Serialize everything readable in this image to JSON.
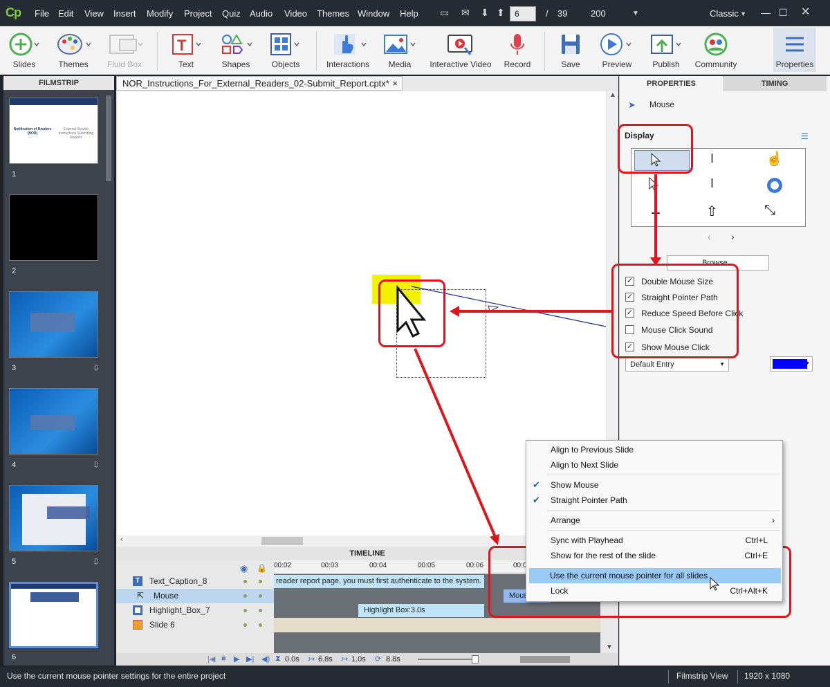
{
  "app": {
    "logo": "Cp",
    "workspace": "Classic"
  },
  "menu": [
    "File",
    "Edit",
    "View",
    "Insert",
    "Modify",
    "Project",
    "Quiz",
    "Audio",
    "Video",
    "Themes",
    "Window",
    "Help"
  ],
  "nav": {
    "current_page": "6",
    "separator": "/",
    "total_pages": "39",
    "zoom": "200"
  },
  "toolbar": [
    "Slides",
    "Themes",
    "Fluid Box",
    "Text",
    "Shapes",
    "Objects",
    "Interactions",
    "Media",
    "Interactive Video",
    "Record",
    "Save",
    "Preview",
    "Publish",
    "Community",
    "Properties"
  ],
  "filmstrip": {
    "title": "FILMSTRIP",
    "slide1_title": "Notification of Readers (NOR)",
    "slide1_subtitle": "External Reader Instructions Submitting Reports",
    "numbers": [
      "1",
      "2",
      "3",
      "4",
      "5",
      "6"
    ]
  },
  "document": {
    "tab_title": "NOR_Instructions_For_External_Readers_02-Submit_Report.cptx*",
    "close": "×"
  },
  "timeline": {
    "title": "TIMELINE",
    "ticks": [
      "00:02",
      "00:03",
      "00:04",
      "00:05",
      "00:06",
      "00:0"
    ],
    "layers": [
      {
        "name": "Text_Caption_8",
        "bar": "reader report page, you must first authenticate to the system.   The fi..."
      },
      {
        "name": "Mouse",
        "bar": "Mous"
      },
      {
        "name": "Highlight_Box_7",
        "bar": "Highlight Box:3.0s"
      },
      {
        "name": "Slide 6",
        "bar": ""
      }
    ],
    "footer": {
      "start": "0.0s",
      "duration": "6.8s",
      "mid": "1.0s",
      "end": "8.8s"
    }
  },
  "properties": {
    "tab_properties": "PROPERTIES",
    "tab_timing": "TIMING",
    "object_type": "Mouse",
    "section": "Display",
    "browse": "Browse...",
    "options": [
      {
        "label": "Double Mouse Size",
        "checked": true
      },
      {
        "label": "Straight Pointer Path",
        "checked": true
      },
      {
        "label": "Reduce Speed Before Click",
        "checked": true
      },
      {
        "label": "Mouse Click Sound",
        "checked": false
      },
      {
        "label": "Show Mouse Click",
        "checked": true
      }
    ],
    "entry": "Default Entry",
    "click_color": "#0000ff"
  },
  "context_menu": [
    {
      "label": "Align to Previous Slide",
      "shortcut": "",
      "checked": false
    },
    {
      "label": "Align to Next Slide",
      "shortcut": "",
      "checked": false
    },
    {
      "label": "Show Mouse",
      "shortcut": "",
      "checked": true
    },
    {
      "label": "Straight Pointer Path",
      "shortcut": "",
      "checked": true
    },
    {
      "label": "Arrange",
      "shortcut": "›",
      "checked": false
    },
    {
      "label": "Sync with Playhead",
      "shortcut": "Ctrl+L",
      "checked": false
    },
    {
      "label": "Show for the rest of the slide",
      "shortcut": "Ctrl+E",
      "checked": false
    },
    {
      "label": "Use the current mouse pointer for all slides",
      "shortcut": "",
      "checked": false
    },
    {
      "label": "Lock",
      "shortcut": "Ctrl+Alt+K",
      "checked": false
    }
  ],
  "status": {
    "message": "Use the current mouse pointer settings for the entire project",
    "view": "Filmstrip View",
    "resolution": "1920 x 1080"
  },
  "colors": {
    "accent": "#e0141c",
    "highlight": "#f2f200",
    "selection": "#99c9f5",
    "chrome": "#262c33"
  }
}
